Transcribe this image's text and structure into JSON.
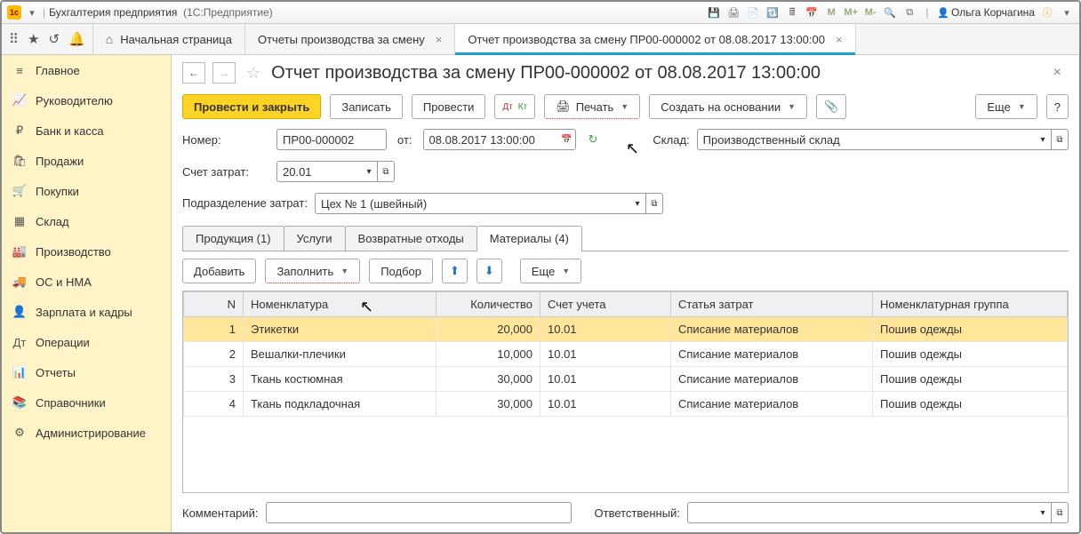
{
  "title": {
    "app": "Бухгалтерия предприятия",
    "platform": "(1С:Предприятие)",
    "user": "Ольга Корчагина"
  },
  "titlebar_icons": {
    "m": "M",
    "mplus": "M+",
    "mminus": "M-"
  },
  "toptabs": {
    "home": "Начальная страница",
    "t1": "Отчеты производства за смену",
    "t2": "Отчет производства за смену ПР00-000002 от 08.08.2017 13:00:00"
  },
  "sidebar": [
    {
      "icon": "≡",
      "label": "Главное"
    },
    {
      "icon": "📈",
      "label": "Руководителю"
    },
    {
      "icon": "₽",
      "label": "Банк и касса"
    },
    {
      "icon": "🛍",
      "label": "Продажи"
    },
    {
      "icon": "🛒",
      "label": "Покупки"
    },
    {
      "icon": "▦",
      "label": "Склад"
    },
    {
      "icon": "🏭",
      "label": "Производство"
    },
    {
      "icon": "🚚",
      "label": "ОС и НМА"
    },
    {
      "icon": "👤",
      "label": "Зарплата и кадры"
    },
    {
      "icon": "Дт",
      "label": "Операции"
    },
    {
      "icon": "📊",
      "label": "Отчеты"
    },
    {
      "icon": "📚",
      "label": "Справочники"
    },
    {
      "icon": "⚙",
      "label": "Администрирование"
    }
  ],
  "doc": {
    "title": "Отчет производства за смену ПР00-000002 от 08.08.2017 13:00:00"
  },
  "toolbar": {
    "post_close": "Провести и закрыть",
    "save": "Записать",
    "post": "Провести",
    "print": "Печать",
    "create_based": "Создать на основании",
    "more": "Еще",
    "help": "?"
  },
  "fields": {
    "number_lbl": "Номер:",
    "number": "ПР00-000002",
    "from_lbl": "от:",
    "date": "08.08.2017 13:00:00",
    "warehouse_lbl": "Склад:",
    "warehouse": "Производственный склад",
    "cost_acct_lbl": "Счет затрат:",
    "cost_acct": "20.01",
    "dept_lbl": "Подразделение затрат:",
    "dept": "Цех № 1 (швейный)"
  },
  "tabs": {
    "products": "Продукция (1)",
    "services": "Услуги",
    "returns": "Возвратные отходы",
    "materials": "Материалы (4)"
  },
  "subtb": {
    "add": "Добавить",
    "fill": "Заполнить",
    "select": "Подбор",
    "more": "Еще"
  },
  "cols": {
    "n": "N",
    "nom": "Номенклатура",
    "qty": "Количество",
    "acct": "Счет учета",
    "cost_item": "Статья затрат",
    "nom_group": "Номенклатурная группа"
  },
  "rows": [
    {
      "n": "1",
      "nom": "Этикетки",
      "qty": "20,000",
      "acct": "10.01",
      "cost": "Списание материалов",
      "grp": "Пошив одежды"
    },
    {
      "n": "2",
      "nom": "Вешалки-плечики",
      "qty": "10,000",
      "acct": "10.01",
      "cost": "Списание материалов",
      "grp": "Пошив одежды"
    },
    {
      "n": "3",
      "nom": "Ткань костюмная",
      "qty": "30,000",
      "acct": "10.01",
      "cost": "Списание материалов",
      "grp": "Пошив одежды"
    },
    {
      "n": "4",
      "nom": "Ткань подкладочная",
      "qty": "30,000",
      "acct": "10.01",
      "cost": "Списание материалов",
      "grp": "Пошив одежды"
    }
  ],
  "footer": {
    "comment_lbl": "Комментарий:",
    "resp_lbl": "Ответственный:"
  }
}
